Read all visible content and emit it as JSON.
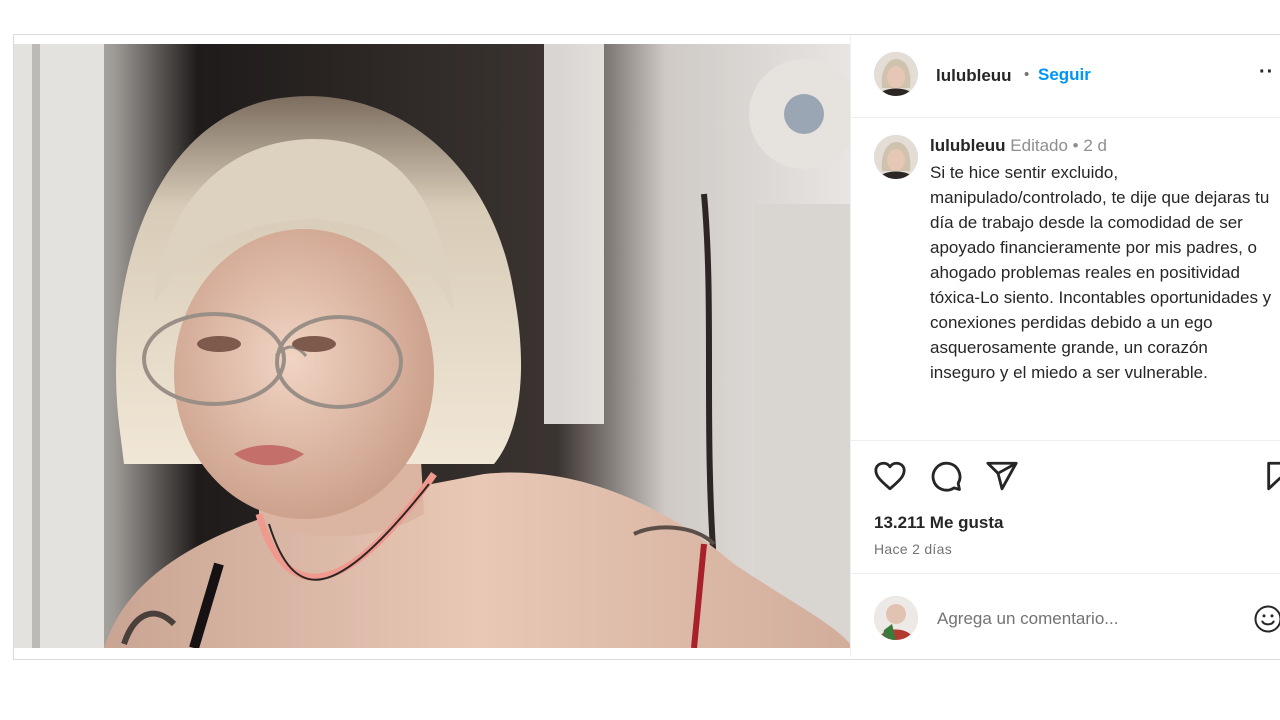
{
  "post": {
    "username": "lulubleuu",
    "follow_label": "Seguir",
    "separator": "•",
    "more_icon": "more-horizontal-icon",
    "caption": {
      "username": "lulubleuu",
      "meta": "Editado • 2 d",
      "text": "Si te hice sentir excluido, manipulado/controlado, te dije que dejaras tu día de trabajo desde la comodidad de ser apoyado financieramente por mis padres, o ahogado problemas reales en positividad tóxica-Lo siento. Incontables oportunidades y conexiones perdidas debido a un ego asquerosamente grande, un corazón inseguro y el miedo a ser vulnerable."
    },
    "actions": {
      "like_icon": "heart-icon",
      "comment_icon": "comment-icon",
      "share_icon": "send-icon",
      "save_icon": "bookmark-icon"
    },
    "likes": "13.211 Me gusta",
    "time_ago": "Hace 2 días",
    "comment_box": {
      "placeholder": "Agrega un comentario...",
      "emoji_icon": "emoji-icon"
    }
  }
}
